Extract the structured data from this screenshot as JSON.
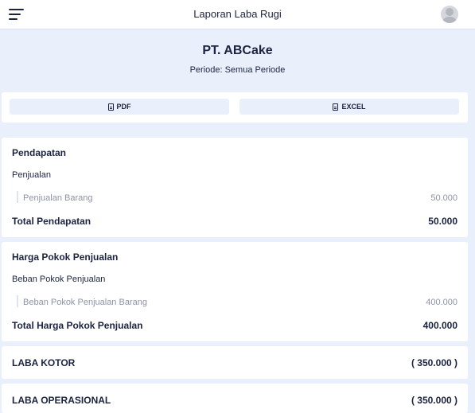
{
  "header": {
    "title": "Laporan Laba Rugi"
  },
  "company": {
    "name": "PT. ABCake",
    "period": "Periode: Semua Periode"
  },
  "export": {
    "pdf_label": "PDF",
    "excel_label": "EXCEL"
  },
  "pendapatan": {
    "title": "Pendapatan",
    "group": "Penjualan",
    "items": [
      {
        "label": "Penjualan Barang",
        "value": "50.000"
      }
    ],
    "total_label": "Total Pendapatan",
    "total_value": "50.000"
  },
  "hpp": {
    "title": "Harga Pokok Penjualan",
    "group": "Beban Pokok Penjualan",
    "items": [
      {
        "label": "Beban Pokok Penjualan Barang",
        "value": "400.000"
      }
    ],
    "total_label": "Total Harga Pokok Penjualan",
    "total_value": "400.000"
  },
  "laba_kotor": {
    "label": "LABA KOTOR",
    "value": "( 350.000 )"
  },
  "laba_operasional": {
    "label": "LABA OPERASIONAL",
    "value": "( 350.000 )"
  }
}
